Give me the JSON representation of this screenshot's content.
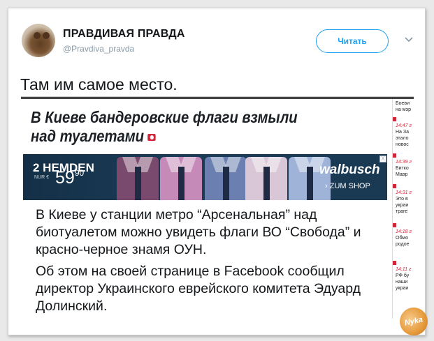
{
  "tweet": {
    "account_name": "ПРАВДИВАЯ ПРАВДА",
    "handle": "@Pravdiva_pravda",
    "follow_label": "Читать",
    "text": "Там им самое место."
  },
  "article": {
    "headline_line1": "В Киеве бандеровские флаги взмыли",
    "headline_line2": "над туалетами",
    "paragraph1": "В Киеве у станции метро “Арсенальная” над биотуалетом можно увидеть флаги ВО “Свобода” и красно-черное знамя ОУН.",
    "paragraph2": "Об этом на своей странице в Facebook сообщил директор Украинского еврейского комитета Эдуард Долинский."
  },
  "ad": {
    "headline": "2 HEMDEN",
    "price_prefix": "NUR €",
    "price_main": "59",
    "price_cents": "90",
    "brand": "walbusch",
    "shop_label": "ZUM SHOP",
    "close_label": "X",
    "shirt_colors": [
      "#7a4a6e",
      "#c58ab8",
      "#6b7fb0",
      "#d9c6d6",
      "#9fb3d9",
      "#3d4f7a"
    ]
  },
  "sidebar": {
    "items": [
      {
        "time": "",
        "text": "Боеви\nна мэр"
      },
      {
        "time": "14:47 г",
        "text": "На За\nэтало\nновос"
      },
      {
        "time": "14:39 г",
        "text": "Битко\nМавр"
      },
      {
        "time": "14:31 г",
        "text": "Это в\nукраи\nтраге"
      },
      {
        "time": "14:18 г",
        "text": "Обмо\nродое"
      },
      {
        "time": "14:11 г",
        "text": "РФ бу\nнаши\nукраи"
      }
    ]
  },
  "watermark": {
    "text": "Nyka"
  },
  "colors": {
    "accent": "#1da1f2",
    "news_red": "#d0283a",
    "ad_background": "#1a3952"
  }
}
